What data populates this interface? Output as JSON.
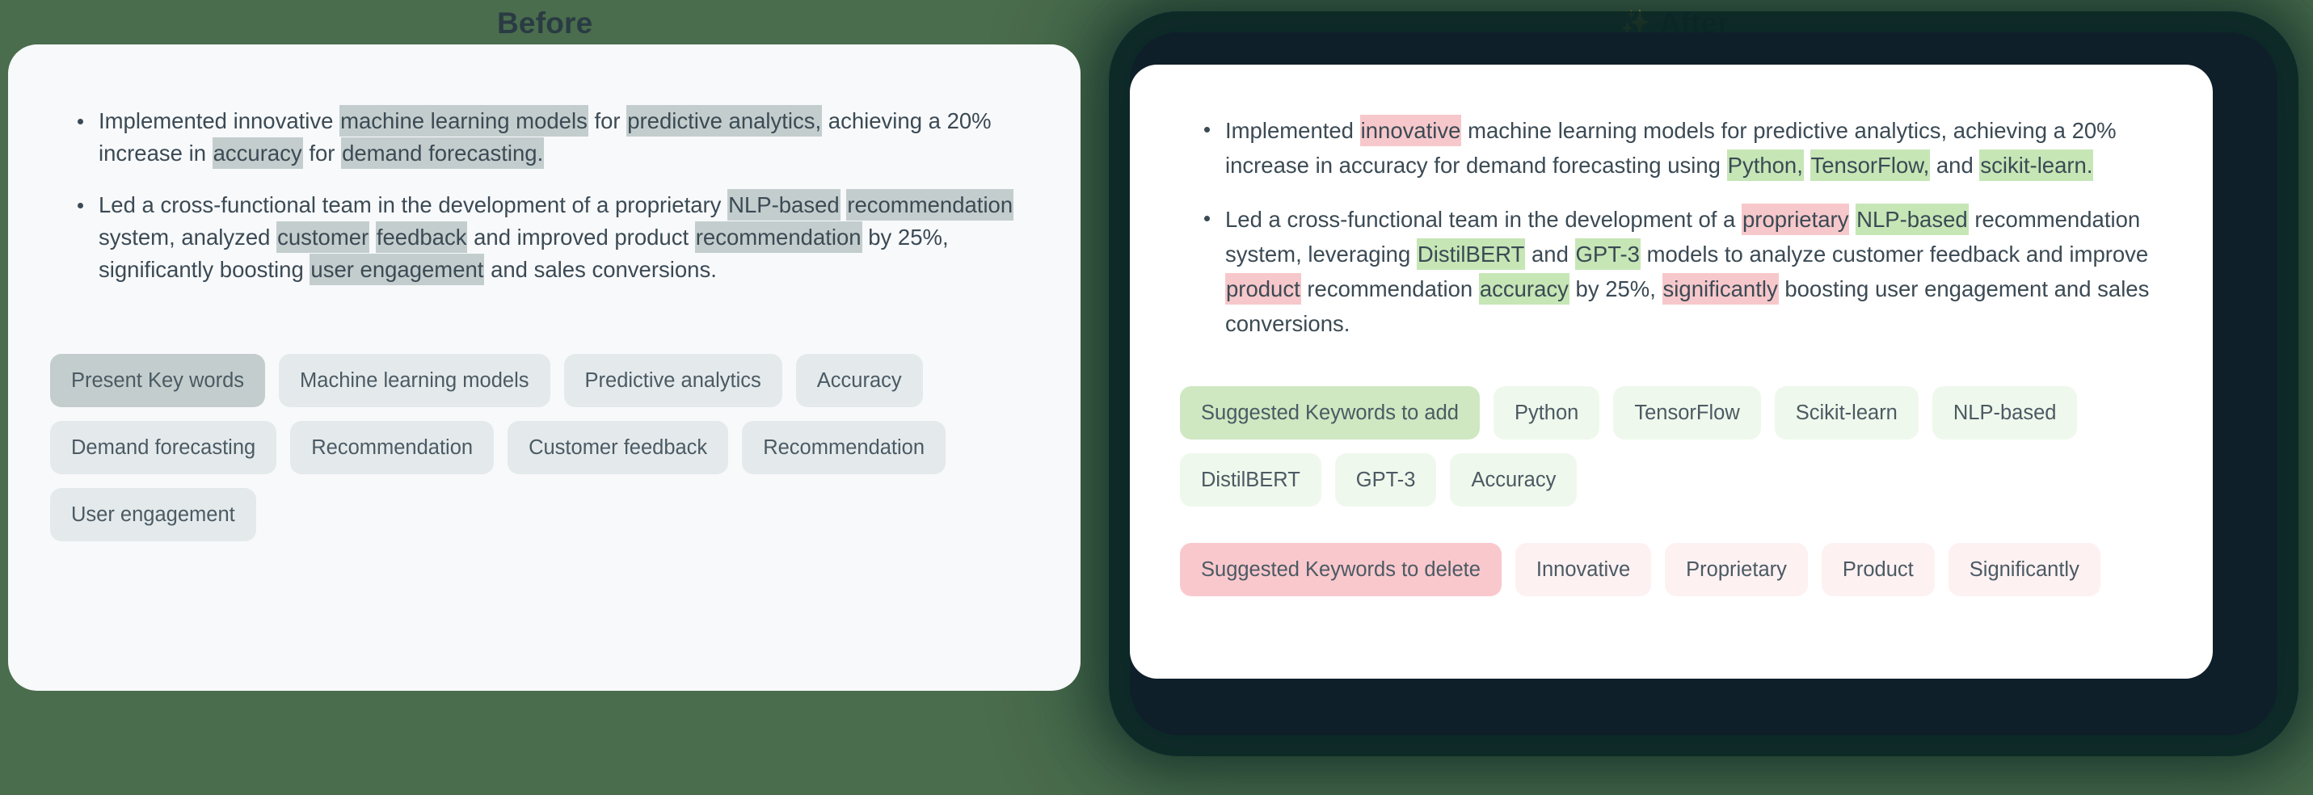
{
  "background_color": "#4a6d4d",
  "headings": {
    "before": "Before",
    "after": "After",
    "after_icon": "sparkles-icon",
    "after_icon_glyph": "✨"
  },
  "before_card": {
    "background_color": "#f8f9fb",
    "highlight_color": "#c3cdcd",
    "bullets": [
      {
        "id": "bullet-1",
        "segments": [
          {
            "text": "Implemented innovative ",
            "style": "plain"
          },
          {
            "text": "machine learning models",
            "style": "gray"
          },
          {
            "text": " for ",
            "style": "plain"
          },
          {
            "text": "predictive analytics,",
            "style": "gray"
          },
          {
            "text": " achieving a 20% increase in ",
            "style": "plain"
          },
          {
            "text": "accuracy",
            "style": "gray"
          },
          {
            "text": " for ",
            "style": "plain"
          },
          {
            "text": "demand forecasting.",
            "style": "gray"
          }
        ],
        "plain_text": "Implemented innovative machine learning models for predictive analytics, achieving a 20% increase in accuracy for demand forecasting."
      },
      {
        "id": "bullet-2",
        "segments": [
          {
            "text": "Led a cross-functional team in the development of a proprietary ",
            "style": "plain"
          },
          {
            "text": "NLP-based",
            "style": "gray"
          },
          {
            "text": " ",
            "style": "plain"
          },
          {
            "text": "recommendation",
            "style": "gray"
          },
          {
            "text": " system, analyzed ",
            "style": "plain"
          },
          {
            "text": "customer",
            "style": "gray"
          },
          {
            "text": " ",
            "style": "plain"
          },
          {
            "text": "feedback",
            "style": "gray"
          },
          {
            "text": " and improved product ",
            "style": "plain"
          },
          {
            "text": "recommendation",
            "style": "gray"
          },
          {
            "text": " by 25%, significantly boosting ",
            "style": "plain"
          },
          {
            "text": "user engagement",
            "style": "gray"
          },
          {
            "text": " and sales conversions.",
            "style": "plain"
          }
        ],
        "plain_text": "Led a cross-functional team in the development of a proprietary NLP-based recommendation system, analyzed customer feedback and improved product recommendation by 25%, significantly boosting user engagement and sales conversions."
      }
    ],
    "chips": [
      {
        "label": "Present Key words",
        "style": "gray-strong"
      },
      {
        "label": "Machine learning models",
        "style": "gray"
      },
      {
        "label": "Predictive analytics",
        "style": "gray"
      },
      {
        "label": "Accuracy",
        "style": "gray"
      },
      {
        "label": "Demand forecasting",
        "style": "gray"
      },
      {
        "label": "Recommendation",
        "style": "gray"
      },
      {
        "label": "Customer feedback",
        "style": "gray"
      },
      {
        "label": "Recommendation",
        "style": "gray"
      },
      {
        "label": "User engagement",
        "style": "gray"
      }
    ]
  },
  "after_card": {
    "background_color": "#ffffff",
    "glow_color": "#0c2b2b",
    "add_highlight_color": "#c6e6b6",
    "delete_highlight_color": "#f7c8cb",
    "bullets": [
      {
        "id": "bullet-1",
        "segments": [
          {
            "text": "Implemented ",
            "style": "plain"
          },
          {
            "text": "innovative",
            "style": "red"
          },
          {
            "text": " machine learning models for predictive analytics, achieving a 20% increase in accuracy for demand forecasting using ",
            "style": "plain"
          },
          {
            "text": "Python,",
            "style": "green"
          },
          {
            "text": " ",
            "style": "plain"
          },
          {
            "text": "TensorFlow,",
            "style": "green"
          },
          {
            "text": " and ",
            "style": "plain"
          },
          {
            "text": "scikit-learn.",
            "style": "green"
          }
        ],
        "plain_text": "Implemented innovative machine learning models for predictive analytics, achieving a 20% increase in accuracy for demand forecasting using Python, TensorFlow, and scikit-learn."
      },
      {
        "id": "bullet-2",
        "segments": [
          {
            "text": "Led a cross-functional team in the development of a ",
            "style": "plain"
          },
          {
            "text": "proprietary",
            "style": "red"
          },
          {
            "text": " ",
            "style": "plain"
          },
          {
            "text": "NLP-based",
            "style": "green"
          },
          {
            "text": " recommendation system, leveraging ",
            "style": "plain"
          },
          {
            "text": "DistilBERT",
            "style": "green"
          },
          {
            "text": " and ",
            "style": "plain"
          },
          {
            "text": "GPT-3",
            "style": "green"
          },
          {
            "text": " models to analyze customer feedback and improve ",
            "style": "plain"
          },
          {
            "text": "product",
            "style": "red"
          },
          {
            "text": " recommendation ",
            "style": "plain"
          },
          {
            "text": "accuracy",
            "style": "green"
          },
          {
            "text": " by 25%, ",
            "style": "plain"
          },
          {
            "text": "significantly",
            "style": "red"
          },
          {
            "text": " boosting user engagement and sales conversions.",
            "style": "plain"
          }
        ],
        "plain_text": "Led a cross-functional team in the development of a proprietary NLP-based recommendation system, leveraging DistilBERT and GPT-3 models to analyze customer feedback and improve product recommendation accuracy by 25%, significantly boosting user engagement and sales conversions."
      }
    ],
    "chips_add": [
      {
        "label": "Suggested Keywords to add",
        "style": "green-strong"
      },
      {
        "label": "Python",
        "style": "green"
      },
      {
        "label": "TensorFlow",
        "style": "green"
      },
      {
        "label": "Scikit-learn",
        "style": "green"
      },
      {
        "label": "NLP-based",
        "style": "green"
      },
      {
        "label": "DistilBERT",
        "style": "green"
      },
      {
        "label": "GPT-3",
        "style": "green"
      },
      {
        "label": "Accuracy",
        "style": "green"
      }
    ],
    "chips_delete": [
      {
        "label": "Suggested Keywords to delete",
        "style": "pink-strong"
      },
      {
        "label": "Innovative",
        "style": "pink"
      },
      {
        "label": "Proprietary",
        "style": "pink"
      },
      {
        "label": "Product",
        "style": "pink"
      },
      {
        "label": "Significantly",
        "style": "pink"
      }
    ]
  }
}
